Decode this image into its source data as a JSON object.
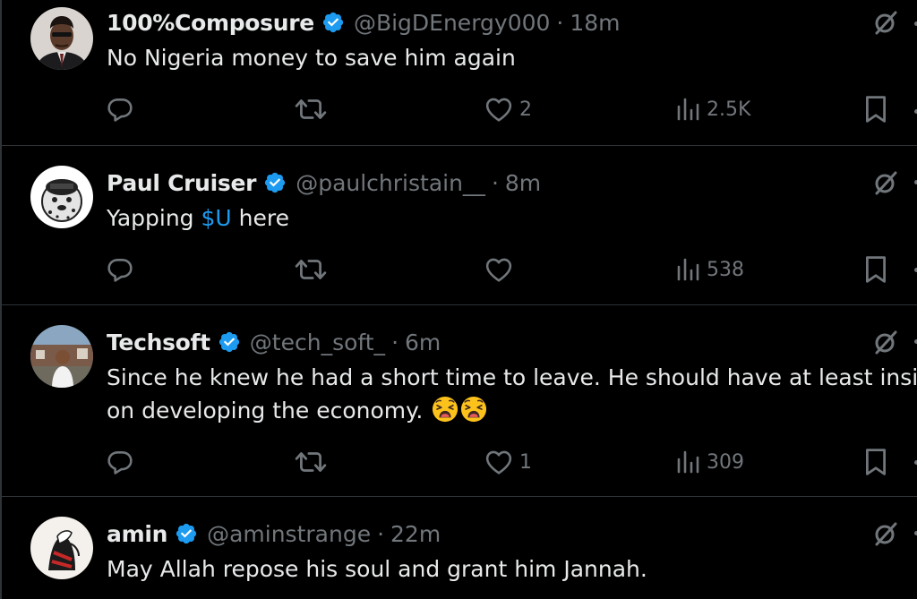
{
  "tweets": [
    {
      "name": "100%Composure",
      "handle": "@BigDEnergy000",
      "separator": "·",
      "time": "18m",
      "text": "No Nigeria money to save him again",
      "likes": "2",
      "views": "2.5K"
    },
    {
      "name": "Paul Cruiser",
      "handle": "@paulchristain__",
      "separator": "·",
      "time": "8m",
      "text_before": "Yapping ",
      "cashtag": "$U",
      "text_after": " here",
      "likes": "",
      "views": "538"
    },
    {
      "name": "Techsoft",
      "handle": "@tech_soft_",
      "separator": "·",
      "time": "6m",
      "text_line1": "Since he knew he had a short time to leave. He should have at least insiste",
      "text_line2": "on developing the economy.",
      "likes": "1",
      "views": "309"
    },
    {
      "name": "amin",
      "handle": "@aminstrange",
      "separator": "·",
      "time": "22m",
      "text": "May Allah repose his soul and grant him Jannah."
    }
  ],
  "colors": {
    "background": "#000000",
    "text": "#e7e9ea",
    "muted": "#71767b",
    "verified": "#1d9bf0",
    "cashtag": "#1d9bf0",
    "divider": "#2f3336"
  },
  "icons": {
    "verified": "verified-badge-icon",
    "grok": "grok-icon",
    "reply": "reply-icon",
    "retweet": "retweet-icon",
    "like": "heart-icon",
    "views": "views-chart-icon",
    "bookmark": "bookmark-icon",
    "emoji": "weary-face-emoji"
  }
}
